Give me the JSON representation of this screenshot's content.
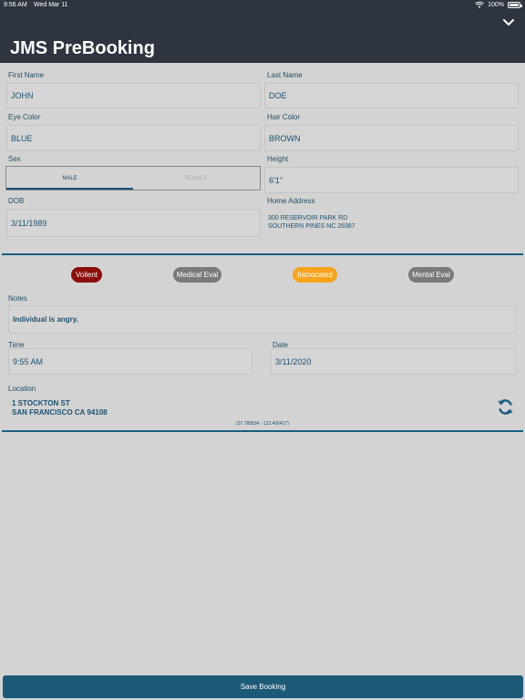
{
  "status_bar": {
    "time": "9:56 AM",
    "date": "Wed Mar 11",
    "battery": "100%"
  },
  "app_title": "JMS PreBooking",
  "form": {
    "first_name": {
      "label": "First Name",
      "value": "JOHN"
    },
    "last_name": {
      "label": "Last Name",
      "value": "DOE"
    },
    "eye_color": {
      "label": "Eye Color",
      "value": "BLUE"
    },
    "hair_color": {
      "label": "Hair Color",
      "value": "BROWN"
    },
    "sex": {
      "label": "Sex",
      "options": [
        "MALE",
        "FEMALE"
      ],
      "selected": "MALE"
    },
    "height": {
      "label": "Height",
      "value": "6'1\""
    },
    "dob": {
      "label": "DOB",
      "value": "3/11/1989"
    },
    "home_address": {
      "label": "Home Address",
      "value": "300 RESERVOIR PARK RD\nSOUTHERN PINES NC 28387"
    }
  },
  "flags": [
    {
      "label": "Voilent",
      "color": "#8b0d0d"
    },
    {
      "label": "Medical Eval",
      "color": "#7a7a7a"
    },
    {
      "label": "Intoxicated",
      "color": "#f7a41d"
    },
    {
      "label": "Mental Eval",
      "color": "#7a7a7a"
    }
  ],
  "notes": {
    "label": "Notes",
    "value": "Individual is angry."
  },
  "time": {
    "label": "Time",
    "value": "9:55 AM"
  },
  "date": {
    "label": "Date",
    "value": "3/11/2020"
  },
  "location": {
    "label": "Location",
    "address": "1 STOCKTON ST\nSAN FRANCISCO CA 94108",
    "coords": "(37.785834, -122.406417)"
  },
  "save_button": "Save Booking",
  "colors": {
    "header_bg": "#2e3540",
    "accent": "#1b5e80",
    "background": "#d3d3d3"
  },
  "icons": {
    "collapse": "chevron-down-icon",
    "refresh": "refresh-icon",
    "wifi": "wifi-icon",
    "battery": "battery-icon"
  }
}
